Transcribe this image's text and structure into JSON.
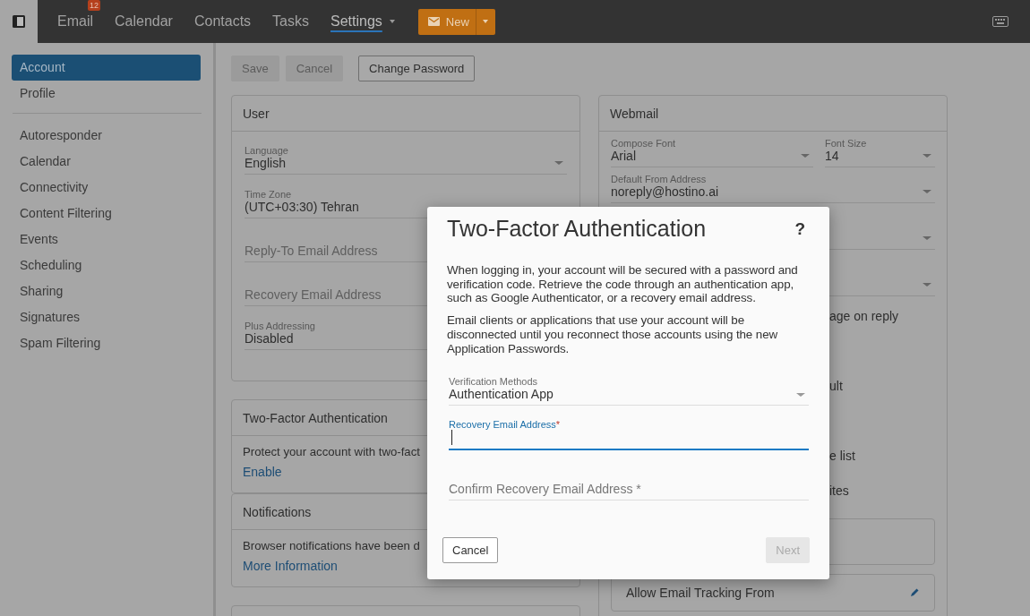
{
  "topbar": {
    "nav": [
      {
        "label": "Email",
        "badge": "12",
        "selected": false,
        "dropdown": false
      },
      {
        "label": "Calendar",
        "selected": false,
        "dropdown": false
      },
      {
        "label": "Contacts",
        "selected": false,
        "dropdown": false
      },
      {
        "label": "Tasks",
        "selected": false,
        "dropdown": false
      },
      {
        "label": "Settings",
        "selected": true,
        "dropdown": true
      }
    ],
    "new_button": {
      "label": "New"
    }
  },
  "sidebar": {
    "groups": [
      [
        {
          "label": "Account",
          "selected": true
        },
        {
          "label": "Profile",
          "selected": false
        }
      ],
      [
        {
          "label": "Autoresponder",
          "selected": false
        },
        {
          "label": "Calendar",
          "selected": false
        },
        {
          "label": "Connectivity",
          "selected": false
        },
        {
          "label": "Content Filtering",
          "selected": false
        },
        {
          "label": "Events",
          "selected": false
        },
        {
          "label": "Scheduling",
          "selected": false
        },
        {
          "label": "Sharing",
          "selected": false
        },
        {
          "label": "Signatures",
          "selected": false
        },
        {
          "label": "Spam Filtering",
          "selected": false
        }
      ]
    ]
  },
  "toolbar": {
    "buttons": [
      {
        "label": "Save",
        "disabled": true
      },
      {
        "label": "Cancel",
        "disabled": true
      },
      {
        "label": "Change Password",
        "disabled": false
      }
    ]
  },
  "user_panel": {
    "title": "User",
    "fields": [
      {
        "kind": "select",
        "label": "Language",
        "value": "English"
      },
      {
        "kind": "text",
        "label": "Time Zone",
        "value": "(UTC+03:30) Tehran"
      },
      {
        "kind": "text",
        "placeholder": "Reply-To Email Address"
      },
      {
        "kind": "text",
        "placeholder": "Recovery Email Address"
      },
      {
        "kind": "text",
        "label": "Plus Addressing",
        "value": "Disabled"
      }
    ]
  },
  "two_factor_panel": {
    "title": "Two-Factor Authentication",
    "text": "Protect your account with two-fact",
    "link": "Enable"
  },
  "notifications_panel": {
    "title": "Notifications",
    "text": "Browser notifications have been d",
    "link": "More Information"
  },
  "webmail_panel": {
    "title": "Webmail",
    "compose_font": {
      "label": "Compose Font",
      "value": "Arial"
    },
    "font_size": {
      "label": "Font Size",
      "value": "14"
    },
    "default_from": {
      "label": "Default From Address",
      "value": "noreply@hostino.ai"
    },
    "fragments": [
      "age on reply",
      "ult",
      "e list",
      "ites"
    ],
    "tracking": {
      "label": "Allow Email Tracking From"
    }
  },
  "dialog": {
    "title": "Two-Factor Authentication",
    "help": "?",
    "paragraphs": [
      "When logging in, your account will be secured with a password and verification code. Retrieve the code through an authentication app, such as Google Authenticator, or a recovery email address.",
      "Email clients or applications that use your account will be disconnected until you reconnect those accounts using the new Application Passwords."
    ],
    "fields": [
      {
        "kind": "select",
        "label": "Verification Methods",
        "value": "Authentication App",
        "focused": false
      },
      {
        "kind": "input",
        "label": "Recovery Email Address",
        "required": "*",
        "focused": true
      },
      {
        "kind": "input",
        "placeholder": "Confirm Recovery Email Address *",
        "focused": false
      }
    ],
    "buttons": [
      {
        "label": "Cancel",
        "disabled": false
      },
      {
        "label": "Next",
        "disabled": true
      }
    ]
  }
}
